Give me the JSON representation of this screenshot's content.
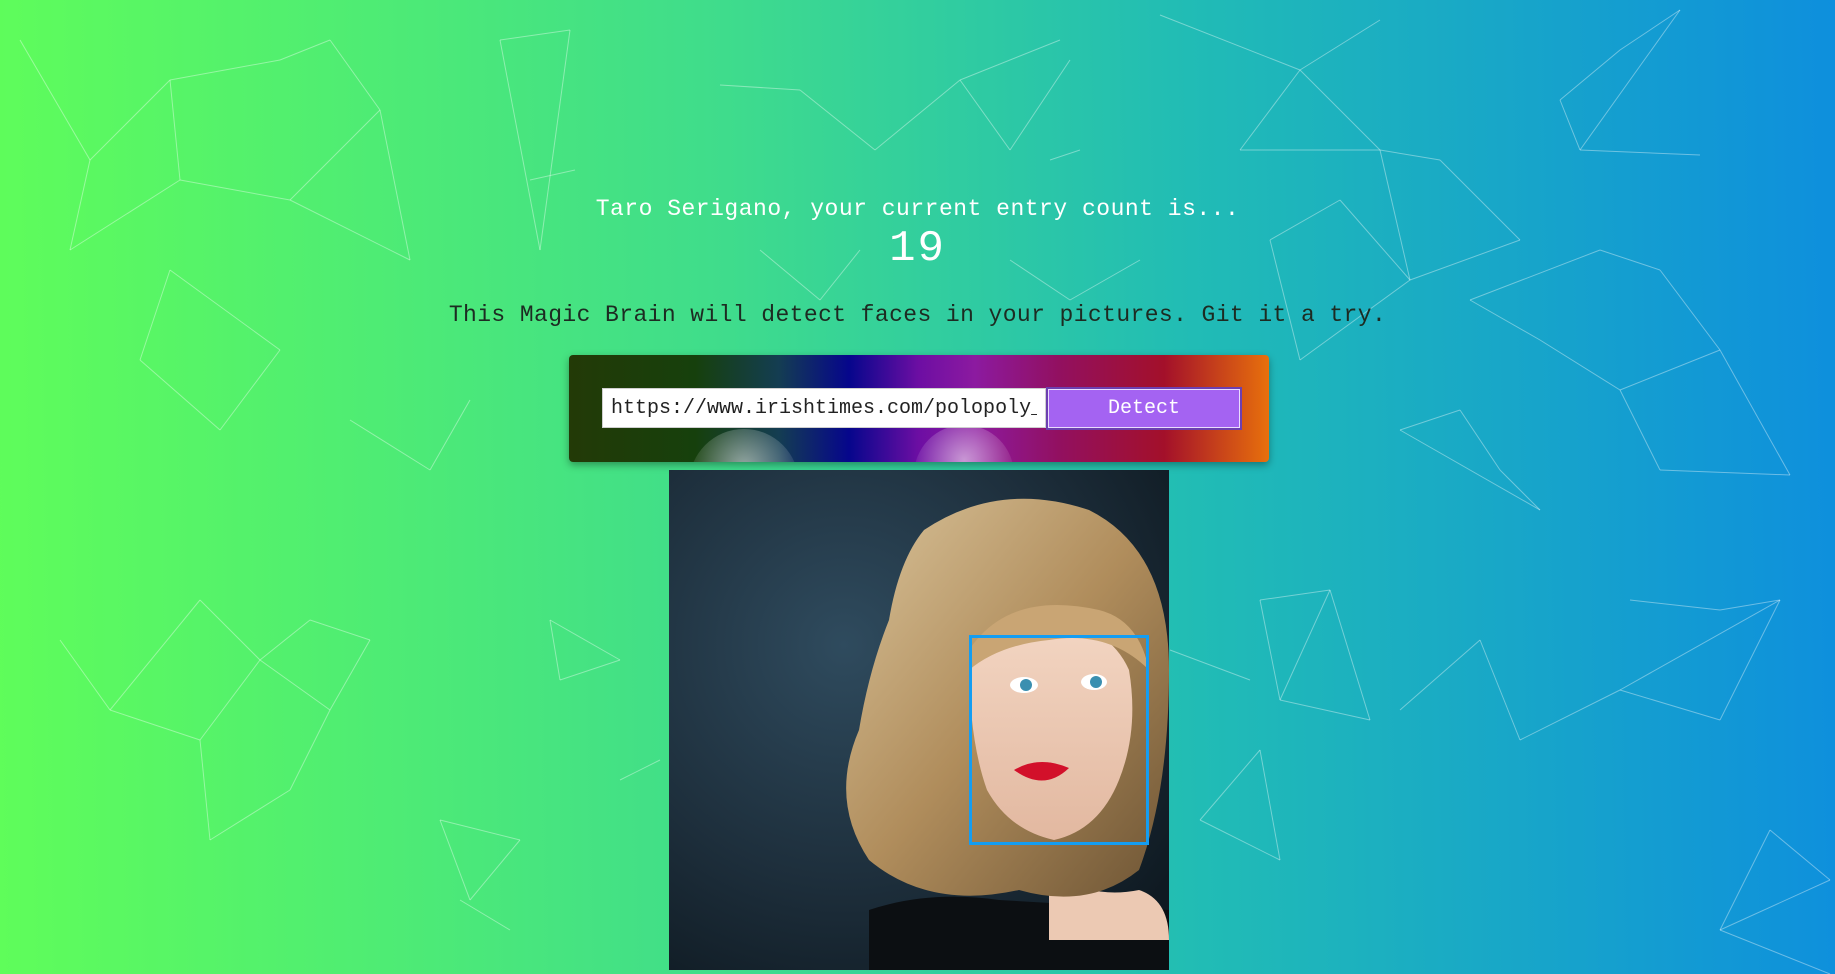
{
  "header": {
    "greeting": "Taro Serigano, your current entry count is...",
    "entry_count": "19"
  },
  "intro": {
    "tagline": "This Magic Brain will detect faces in your pictures. Git it a try."
  },
  "form": {
    "url_value": "https://www.irishtimes.com/polopoly_",
    "detect_label": "Detect"
  },
  "result": {
    "image_alt": "uploaded-photo",
    "faces_detected": 1
  },
  "colors": {
    "button": "#a463f2",
    "face_box": "#149df2"
  }
}
